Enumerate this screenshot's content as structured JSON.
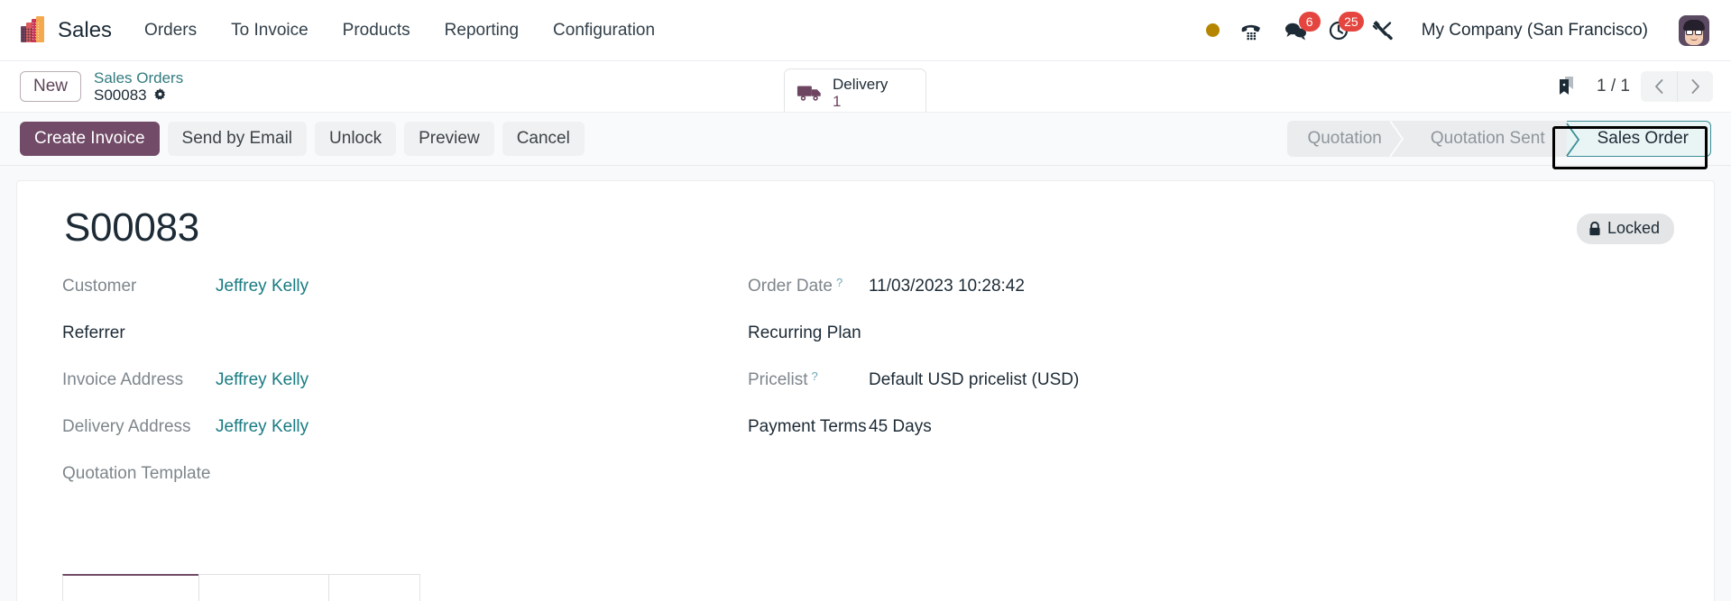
{
  "navbar": {
    "brand_logo_name": "sales-app-logo",
    "app_name": "Sales",
    "menu_items": [
      {
        "label": "Orders"
      },
      {
        "label": "To Invoice"
      },
      {
        "label": "Products"
      },
      {
        "label": "Reporting"
      },
      {
        "label": "Configuration"
      }
    ],
    "status_dot_color": "#b58500",
    "icons": {
      "presence": "presence-dot-icon",
      "dialpad": "phone-dialpad-icon",
      "messages": "messages-icon",
      "activities": "clock-activities-icon",
      "tools": "tools-icon"
    },
    "messages_count": "6",
    "activities_count": "25",
    "company": "My Company (San Francisco)",
    "avatar_name": "user-avatar"
  },
  "control_panel": {
    "new_button": "New",
    "breadcrumb_parent": "Sales Orders",
    "breadcrumb_current": "S00083",
    "smart_button": {
      "label": "Delivery",
      "value": "1",
      "icon": "truck-icon"
    },
    "bookmark_icon": "bookmark-icon",
    "pager_count": "1 / 1",
    "prev_icon": "chevron-left-icon",
    "next_icon": "chevron-right-icon"
  },
  "actions": {
    "buttons": [
      {
        "label": "Create Invoice",
        "style": "primary"
      },
      {
        "label": "Send by Email",
        "style": "secondary"
      },
      {
        "label": "Unlock",
        "style": "secondary"
      },
      {
        "label": "Preview",
        "style": "secondary"
      },
      {
        "label": "Cancel",
        "style": "secondary"
      }
    ]
  },
  "statusbar": {
    "stages": [
      {
        "label": "Quotation",
        "active": false
      },
      {
        "label": "Quotation Sent",
        "active": false
      },
      {
        "label": "Sales Order",
        "active": true
      }
    ],
    "active_color": "#3b8e96",
    "focus_ring_color": "#000000"
  },
  "record": {
    "title": "S00083",
    "locked_badge": "Locked",
    "lock_icon": "lock-icon",
    "left_fields": [
      {
        "label": "Customer",
        "value": "Jeffrey Kelly",
        "link": true,
        "bold_label": false,
        "hint": ""
      },
      {
        "label": "Referrer",
        "value": "",
        "link": false,
        "bold_label": true,
        "hint": ""
      },
      {
        "label": "Invoice Address",
        "value": "Jeffrey Kelly",
        "link": true,
        "bold_label": false,
        "hint": ""
      },
      {
        "label": "Delivery Address",
        "value": "Jeffrey Kelly",
        "link": true,
        "bold_label": false,
        "hint": ""
      },
      {
        "label": "Quotation Template",
        "value": "",
        "link": false,
        "bold_label": false,
        "hint": ""
      }
    ],
    "right_fields": [
      {
        "label": "Order Date",
        "value": "11/03/2023 10:28:42",
        "link": false,
        "bold_label": false,
        "hint": "?"
      },
      {
        "label": "Recurring Plan",
        "value": "",
        "link": false,
        "bold_label": true,
        "hint": ""
      },
      {
        "label": "Pricelist",
        "value": "Default USD pricelist (USD)",
        "link": false,
        "bold_label": false,
        "hint": "?"
      },
      {
        "label": "Payment Terms",
        "value": "45 Days",
        "link": false,
        "bold_label": true,
        "hint": ""
      }
    ],
    "tabs": [
      {
        "label": "",
        "active": true
      },
      {
        "label": "",
        "active": false
      },
      {
        "label": "",
        "active": false
      }
    ]
  }
}
